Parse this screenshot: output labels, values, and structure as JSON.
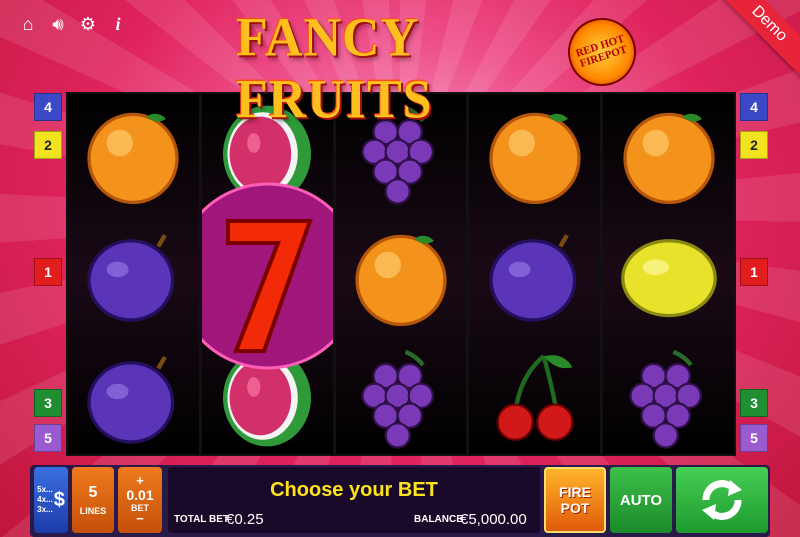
{
  "toolbar": {
    "home_icon": "home-icon",
    "sound_icon": "speaker-icon",
    "settings_icon": "gear-icon",
    "info_label": "i"
  },
  "logo": {
    "title": "FANCY FRUITS",
    "badge_line1": "RED HOT",
    "badge_line2": "FIREPOT"
  },
  "demo_label": "Demo",
  "paylines": {
    "left": [
      "4",
      "2",
      "1",
      "3",
      "5"
    ],
    "right": [
      "4",
      "2",
      "1",
      "3",
      "5"
    ]
  },
  "reels": [
    [
      "orange",
      "plum",
      "plum"
    ],
    [
      "watermelon",
      "seven",
      "watermelon"
    ],
    [
      "grapes",
      "orange",
      "grapes"
    ],
    [
      "orange",
      "plum",
      "cherry"
    ],
    [
      "orange",
      "lemon",
      "grapes"
    ]
  ],
  "controls": {
    "coin_multipliers": [
      "5x...",
      "4x...",
      "3x..."
    ],
    "coin_symbol": "$",
    "lines_value": "5",
    "lines_label": "LINES",
    "bet_plus": "+",
    "bet_value": "0.01",
    "bet_label": "BET",
    "bet_minus": "−",
    "message": "Choose your BET",
    "total_bet_label": "TOTAL BET",
    "total_bet_value": "€0.25",
    "balance_label": "BALANCE",
    "balance_value": "€5,000.00",
    "fire_pot_line1": "FIRE",
    "fire_pot_line2": "POT",
    "auto_label": "AUTO",
    "spin_icon": "refresh-arrows-icon"
  },
  "colors": {
    "accent_yellow": "#ffe31a",
    "bg_pink": "#e0245e",
    "spin_green": "#1d9a2d"
  }
}
